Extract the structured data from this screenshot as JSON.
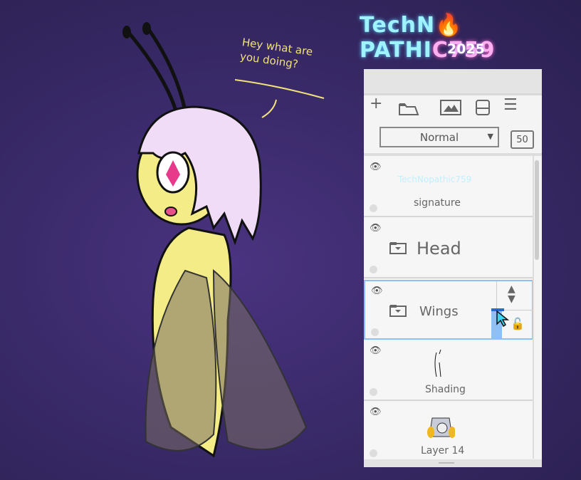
{
  "speech_text": "Hey what are you doing?",
  "logo": {
    "part1": "TechN",
    "flame": "🔥",
    "part2": "PATHI",
    "part3": "C759",
    "year": "2025"
  },
  "panel": {
    "toolbar": {
      "add": "+",
      "menu": "☰"
    },
    "blend_mode": "Normal",
    "opacity": "50",
    "layers": [
      {
        "name": "signature",
        "thumb": "TechNopathic759"
      },
      {
        "name": "Head"
      },
      {
        "name": "Wings",
        "selected": true
      },
      {
        "name": "Shading"
      },
      {
        "name": "Layer 14"
      }
    ]
  },
  "colors": {
    "accent": "#8cc0f6",
    "cursor": "#3ad8f0",
    "speech": "#f2e27a"
  }
}
